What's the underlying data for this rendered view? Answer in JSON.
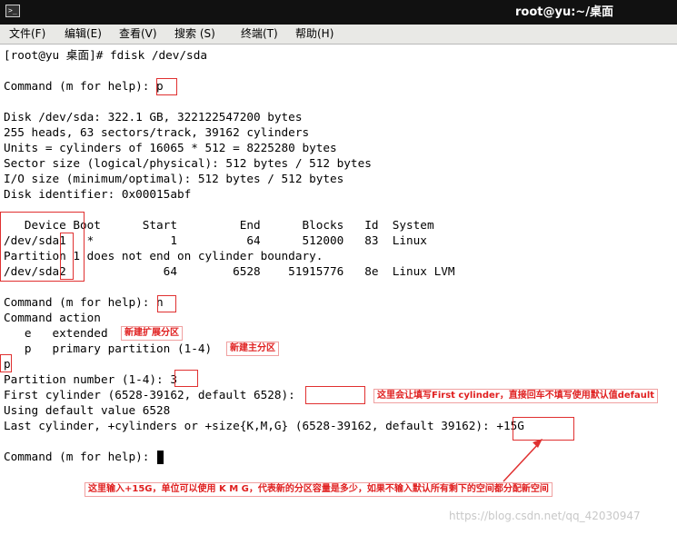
{
  "window": {
    "title": "root@yu:~/桌面",
    "icon": "terminal-icon"
  },
  "menu": [
    "文件(F)",
    "编辑(E)",
    "查看(V)",
    "搜索 (S)",
    "终端(T)",
    "帮助(H)"
  ],
  "terminal": {
    "lines": [
      "[root@yu 桌面]# fdisk /dev/sda",
      "",
      "Command (m for help): p",
      "",
      "Disk /dev/sda: 322.1 GB, 322122547200 bytes",
      "255 heads, 63 sectors/track, 39162 cylinders",
      "Units = cylinders of 16065 * 512 = 8225280 bytes",
      "Sector size (logical/physical): 512 bytes / 512 bytes",
      "I/O size (minimum/optimal): 512 bytes / 512 bytes",
      "Disk identifier: 0x00015abf",
      "",
      "   Device Boot      Start         End      Blocks   Id  System",
      "/dev/sda1   *           1          64      512000   83  Linux",
      "Partition 1 does not end on cylinder boundary.",
      "/dev/sda2              64        6528    51915776   8e  Linux LVM",
      "",
      "Command (m for help): n",
      "Command action",
      "   e   extended",
      "   p   primary partition (1-4)",
      "p",
      "Partition number (1-4): 3",
      "First cylinder (6528-39162, default 6528):",
      "Using default value 6528",
      "Last cylinder, +cylinders or +size{K,M,G} (6528-39162, default 39162): +15G",
      "",
      "Command (m for help): "
    ]
  },
  "annotations": {
    "extended_note": "新建扩展分区",
    "primary_note": "新建主分区",
    "first_cylinder_note": "这里会让填写First cylinder，直接回车不填写使用默认值default",
    "size_note": "这里输入+15G，单位可以使用 K M G，代表新的分区容量是多少，如果不输入默认所有剩下的空间都分配新空间"
  },
  "watermark": "https://blog.csdn.net/qq_42030947",
  "colors": {
    "annotation": "#e03030",
    "titlebar": "#111111",
    "menubar": "#e9e9e6"
  }
}
